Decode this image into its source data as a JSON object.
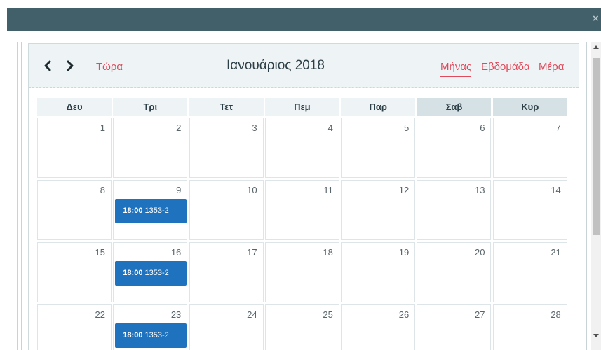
{
  "window": {
    "close_glyph": "×"
  },
  "calendar": {
    "title": "Ιανουάριος 2018",
    "today_label": "Τώρα",
    "prev_icon": "chevron-left-icon",
    "next_icon": "chevron-right-icon",
    "views": {
      "month": "Μήνας",
      "week": "Εβδομάδα",
      "day": "Μέρα"
    },
    "active_view": "month",
    "weekdays": [
      "Δευ",
      "Τρι",
      "Τετ",
      "Πεμ",
      "Παρ",
      "Σαβ",
      "Κυρ"
    ],
    "weeks": [
      {
        "days": [
          {
            "num": "1"
          },
          {
            "num": "2"
          },
          {
            "num": "3"
          },
          {
            "num": "4"
          },
          {
            "num": "5"
          },
          {
            "num": "6"
          },
          {
            "num": "7"
          }
        ]
      },
      {
        "days": [
          {
            "num": "8"
          },
          {
            "num": "9",
            "event": {
              "time": "18:00",
              "title": "1353-2"
            }
          },
          {
            "num": "10"
          },
          {
            "num": "11"
          },
          {
            "num": "12"
          },
          {
            "num": "13"
          },
          {
            "num": "14"
          }
        ]
      },
      {
        "days": [
          {
            "num": "15"
          },
          {
            "num": "16",
            "event": {
              "time": "18:00",
              "title": "1353-2"
            }
          },
          {
            "num": "17"
          },
          {
            "num": "18"
          },
          {
            "num": "19"
          },
          {
            "num": "20"
          },
          {
            "num": "21"
          }
        ]
      },
      {
        "days": [
          {
            "num": "22"
          },
          {
            "num": "23",
            "event": {
              "time": "18:00",
              "title": "1353-2"
            }
          },
          {
            "num": "24"
          },
          {
            "num": "25"
          },
          {
            "num": "26"
          },
          {
            "num": "27"
          },
          {
            "num": "28"
          }
        ]
      }
    ]
  },
  "colors": {
    "titlebar": "#41606a",
    "accent": "#e04a5b",
    "event": "#1f73be",
    "header_bg": "#eef3f5",
    "weekend_header_bg": "#d6e1e5"
  }
}
